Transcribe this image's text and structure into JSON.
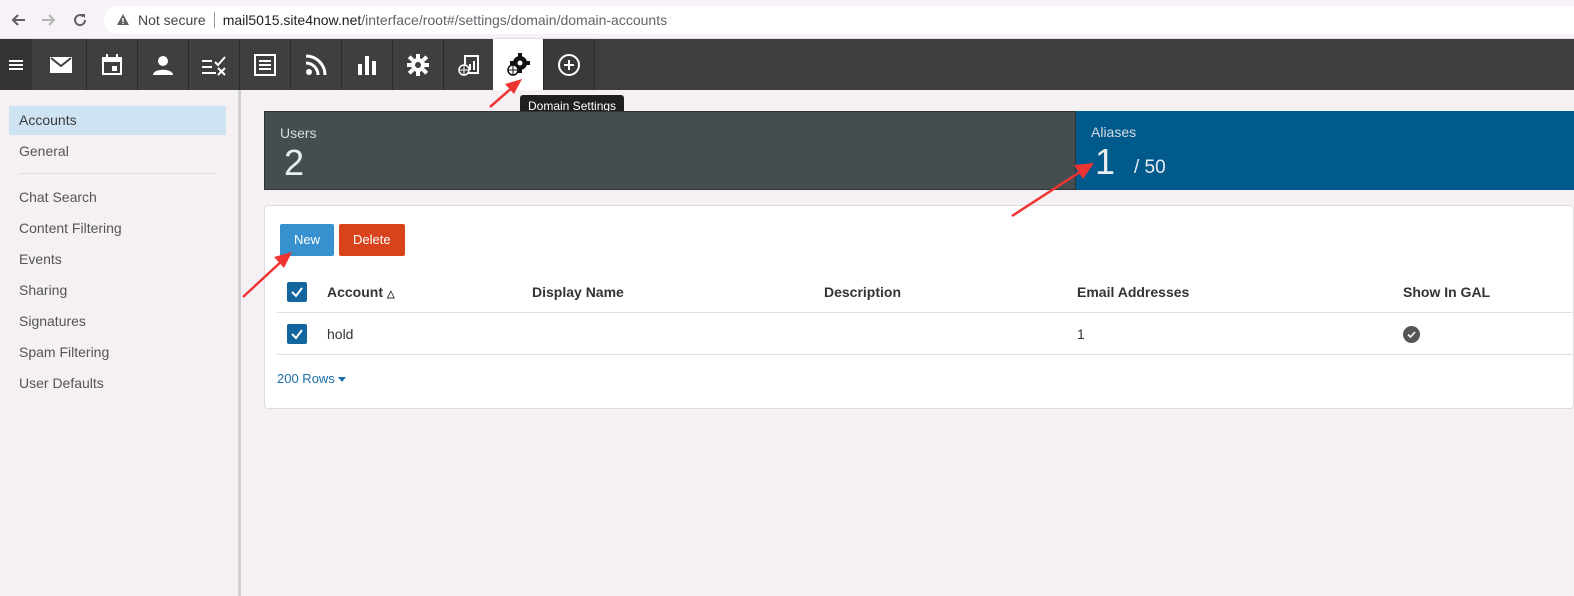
{
  "browser": {
    "security_label": "Not secure",
    "url_host": "mail5015.site4now.net",
    "url_path": "/interface/root#/settings/domain/domain-accounts"
  },
  "toolbar": {
    "icons": [
      "mail-icon",
      "calendar-icon",
      "contacts-icon",
      "tasks-icon",
      "notes-icon",
      "rss-icon",
      "reports-icon",
      "settings-icon",
      "domain-reports-icon",
      "domain-settings-icon",
      "add-icon"
    ],
    "active": "domain-settings-icon",
    "tooltip": "Domain Settings"
  },
  "sidebar": {
    "items": [
      {
        "label": "Accounts",
        "selected": true
      },
      {
        "label": "General"
      },
      {
        "label": "Chat Search"
      },
      {
        "label": "Content Filtering"
      },
      {
        "label": "Events"
      },
      {
        "label": "Sharing"
      },
      {
        "label": "Signatures"
      },
      {
        "label": "Spam Filtering"
      },
      {
        "label": "User Defaults"
      }
    ]
  },
  "stats": {
    "users": {
      "label": "Users",
      "value": "2"
    },
    "aliases": {
      "label": "Aliases",
      "value": "1",
      "limit": "/ 50"
    }
  },
  "actions": {
    "new_label": "New",
    "delete_label": "Delete"
  },
  "table": {
    "columns": [
      "Account",
      "Display Name",
      "Description",
      "Email Addresses",
      "Show In GAL"
    ],
    "rows": [
      {
        "account": "hold",
        "display_name": "",
        "description": "",
        "email_addresses": "1",
        "show_in_gal": true
      }
    ],
    "rows_per_page": "200 Rows"
  },
  "colors": {
    "users_card": "#444e4e",
    "aliases_card": "#005a8c",
    "new_button": "#3891cf",
    "delete_button": "#d9431c",
    "selected_sidebar": "#cfe4f3",
    "annotation_arrow": "#ee3333"
  }
}
